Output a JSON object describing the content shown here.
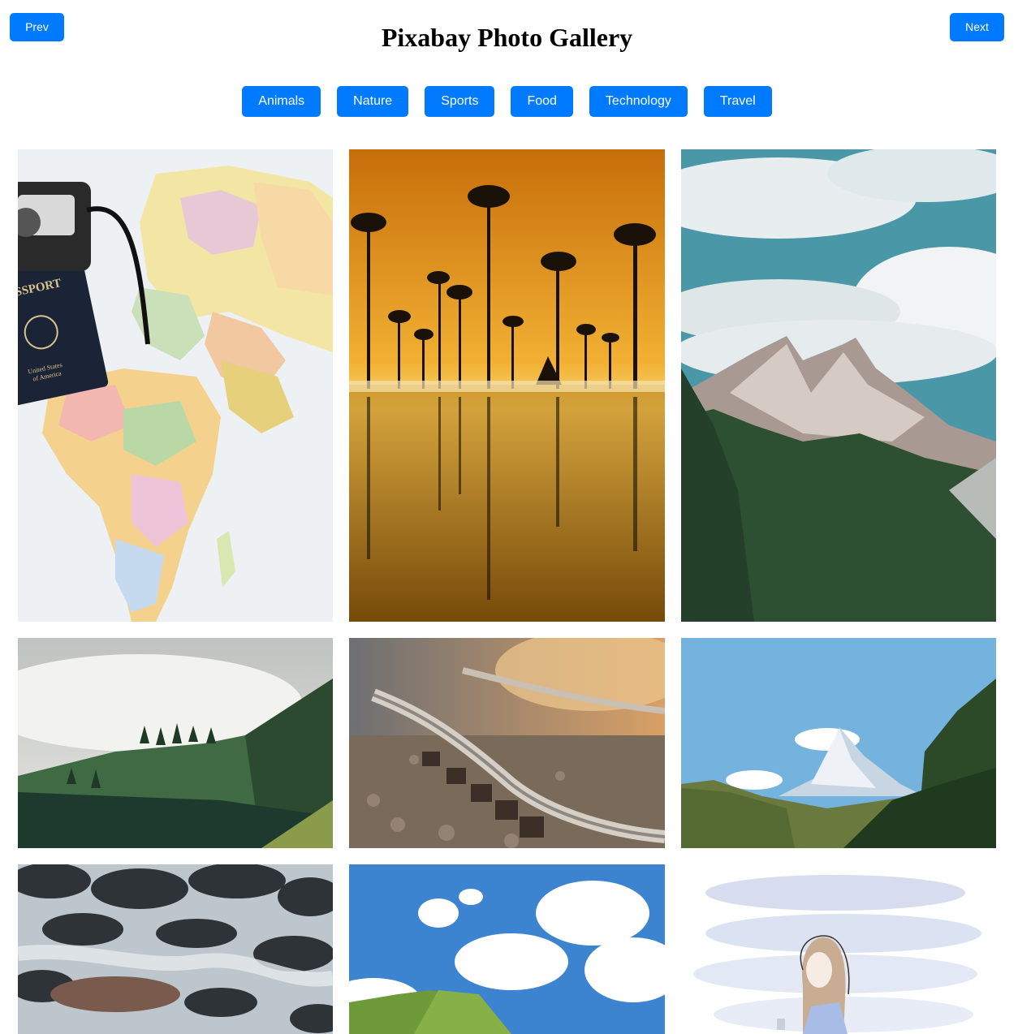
{
  "header": {
    "title": "Pixabay Photo Gallery",
    "prev_label": "Prev",
    "next_label": "Next"
  },
  "categories": [
    "Animals",
    "Nature",
    "Sports",
    "Food",
    "Technology",
    "Travel"
  ],
  "colors": {
    "accent": "#007bff",
    "button_text": "#ffffff",
    "title_text": "#000000"
  },
  "gallery": {
    "images": [
      {
        "subject": "world map with passport and camera"
      },
      {
        "subject": "palm trees reflected in water at golden sunset"
      },
      {
        "subject": "rocky mountain peaks with clouds over pine forest"
      },
      {
        "subject": "misty green hills with pine trees"
      },
      {
        "subject": "curved railway track close-up"
      },
      {
        "subject": "snowy mountain peak under blue sky with forested slopes"
      },
      {
        "subject": "long-exposure stream flowing over rocks"
      },
      {
        "subject": "blue sky with white clouds over green hills"
      },
      {
        "subject": "illustration of a woman with a phone among pastel clouds"
      }
    ]
  }
}
